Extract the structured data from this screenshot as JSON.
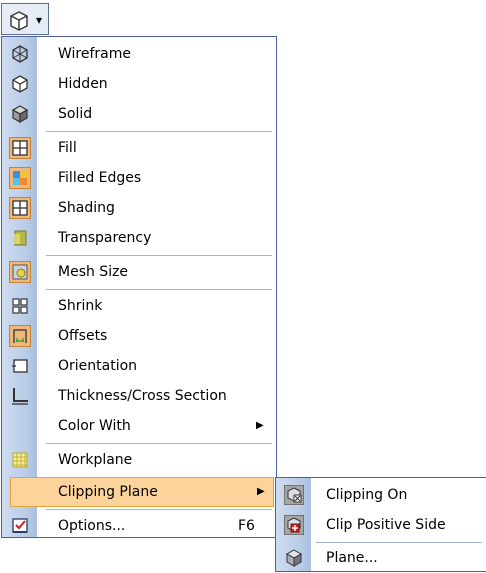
{
  "toolbar": {
    "button_icon": "cube-icon",
    "dropdown_icon": "dropdown-arrow-icon"
  },
  "menu": {
    "items": [
      {
        "label": "Wireframe",
        "icon": "wireframe-cube-icon"
      },
      {
        "label": "Hidden",
        "icon": "hidden-cube-icon"
      },
      {
        "label": "Solid",
        "icon": "solid-cube-icon"
      },
      {
        "label": "Fill",
        "icon": "fill-grid-icon"
      },
      {
        "label": "Filled Edges",
        "icon": "filled-edges-icon"
      },
      {
        "label": "Shading",
        "icon": "shading-grid-icon"
      },
      {
        "label": "Transparency",
        "icon": "transparency-icon"
      },
      {
        "label": "Mesh Size",
        "icon": "mesh-size-icon"
      },
      {
        "label": "Shrink",
        "icon": "shrink-icon"
      },
      {
        "label": "Offsets",
        "icon": "offsets-icon"
      },
      {
        "label": "Orientation",
        "icon": "orientation-icon"
      },
      {
        "label": "Thickness/Cross Section",
        "icon": "cross-section-icon"
      },
      {
        "label": "Color With",
        "icon": "",
        "submenu": true
      },
      {
        "label": "Workplane",
        "icon": "workplane-icon"
      },
      {
        "label": "Clipping Plane",
        "icon": "",
        "submenu": true,
        "highlighted": true
      },
      {
        "label": "Options...",
        "icon": "options-checkbox-icon",
        "shortcut": "F6"
      }
    ]
  },
  "submenu": {
    "items": [
      {
        "label": "Clipping On",
        "icon": "clipping-on-icon"
      },
      {
        "label": "Clip Positive Side",
        "icon": "clip-positive-side-icon"
      },
      {
        "label": "Plane...",
        "icon": "plane-icon"
      }
    ]
  },
  "colors": {
    "gutter": "#b8cce6",
    "border": "#4b61a0",
    "highlight_bg": "#fcd49b",
    "highlight_border": "#e2a33e",
    "icon_highlight": "#f0b97a"
  }
}
